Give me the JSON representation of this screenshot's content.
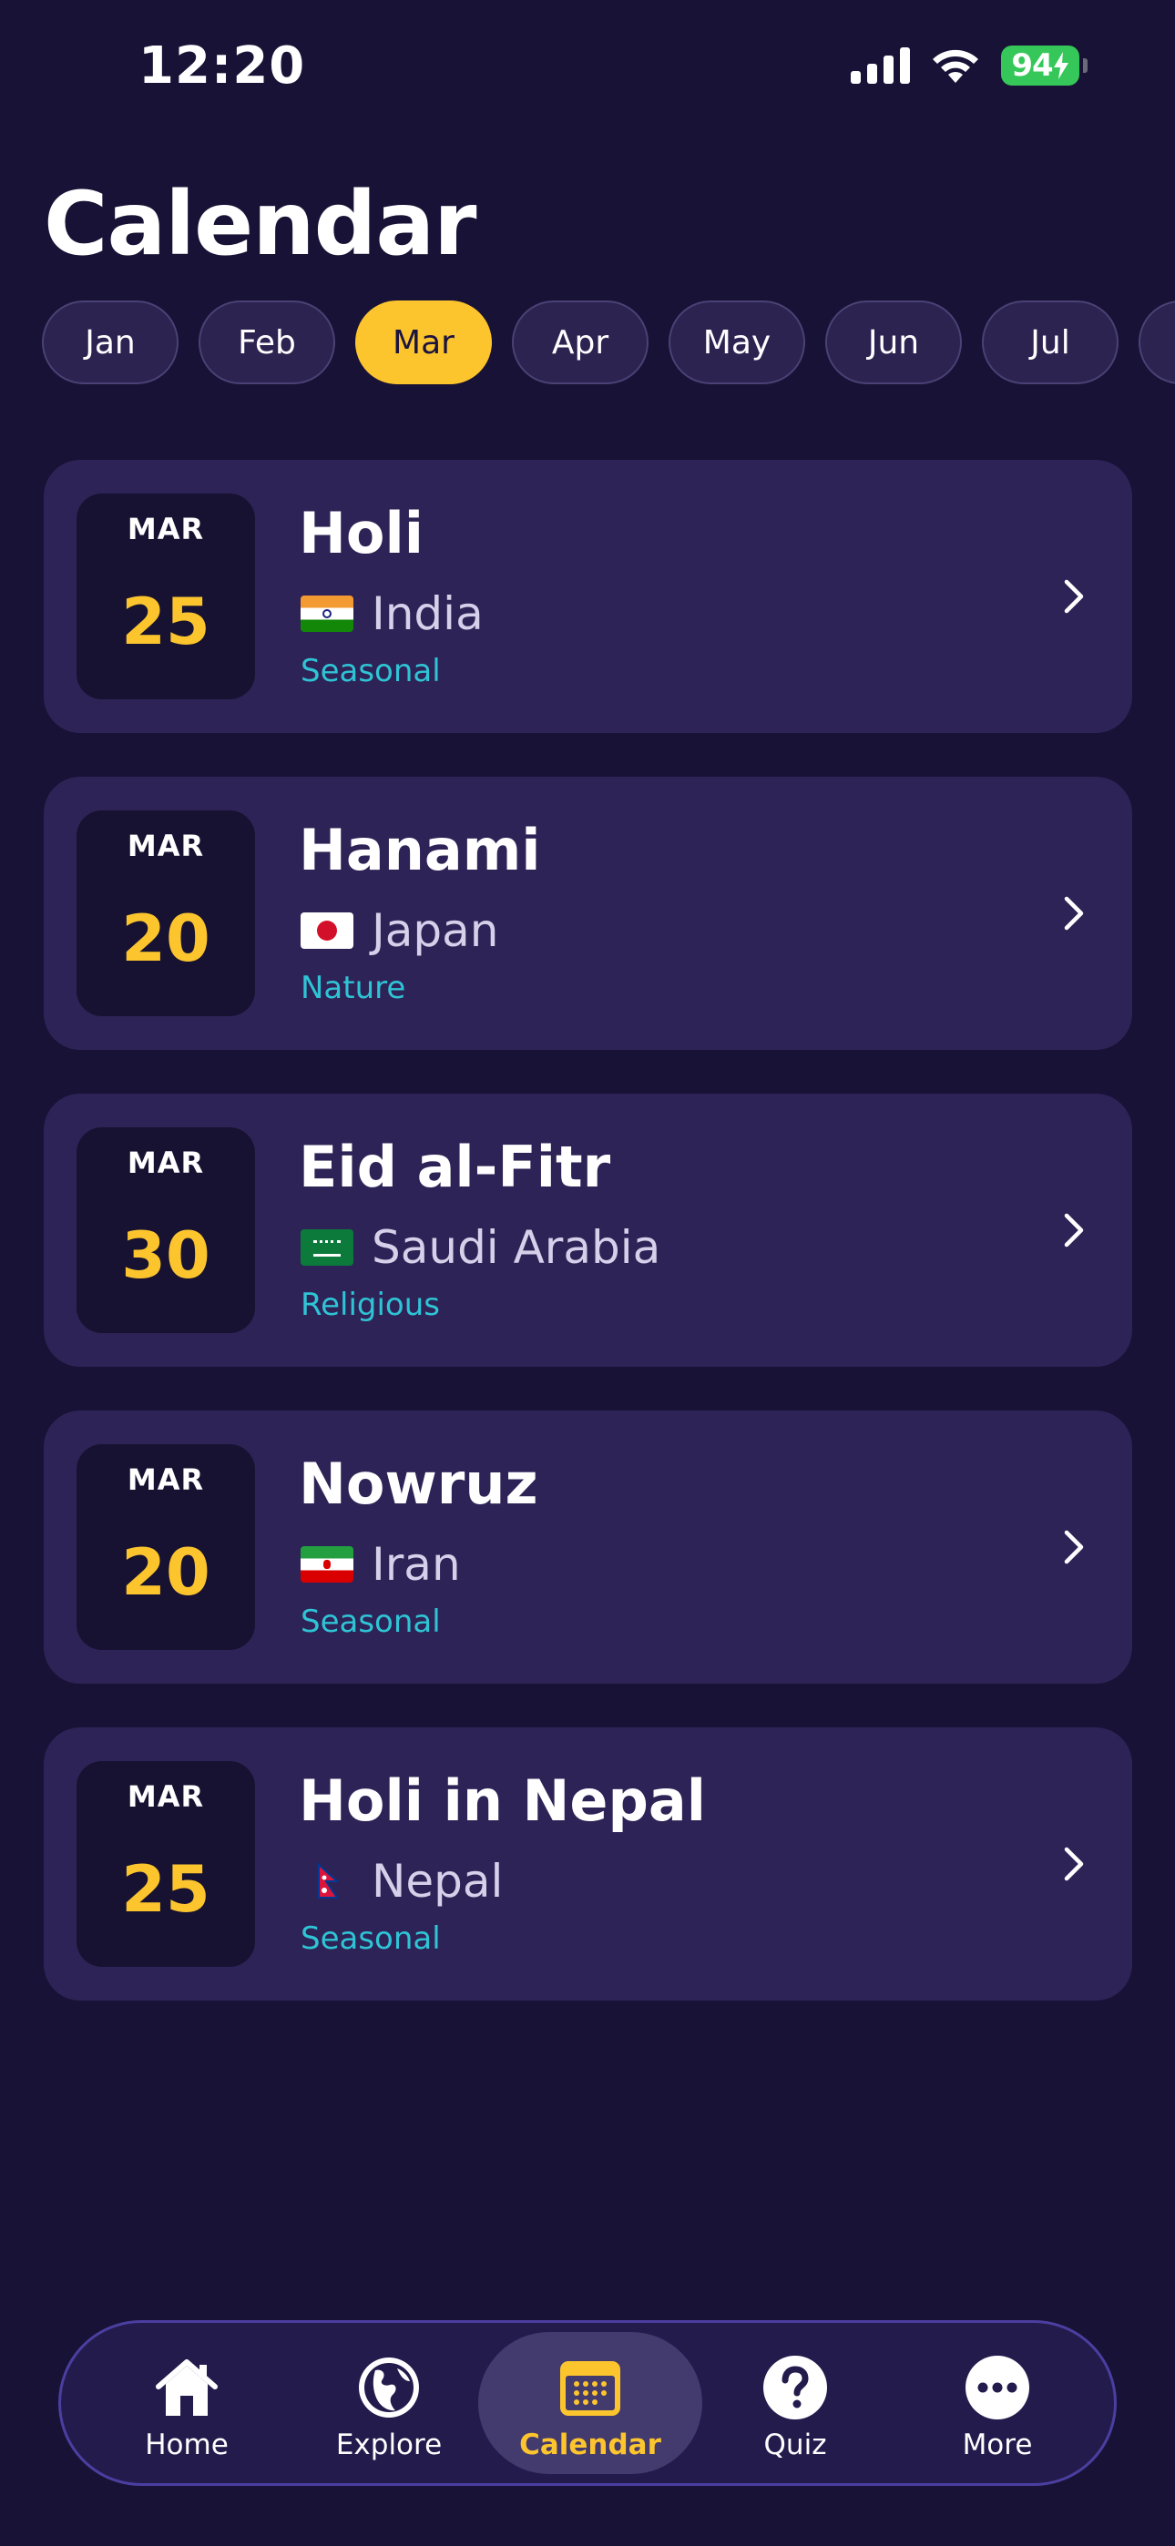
{
  "status_bar": {
    "time": "12:20",
    "battery": "94"
  },
  "page": {
    "title": "Calendar"
  },
  "months": [
    "Jan",
    "Feb",
    "Mar",
    "Apr",
    "May",
    "Jun",
    "Jul",
    ""
  ],
  "selected_month": "Mar",
  "events": [
    {
      "month": "MAR",
      "day": "25",
      "name": "Holi",
      "country": "India",
      "flag": "india-flag-icon",
      "category": "Seasonal"
    },
    {
      "month": "MAR",
      "day": "20",
      "name": "Hanami",
      "country": "Japan",
      "flag": "japan-flag-icon",
      "category": "Nature"
    },
    {
      "month": "MAR",
      "day": "30",
      "name": "Eid al-Fitr",
      "country": "Saudi Arabia",
      "flag": "saudi-arabia-flag-icon",
      "category": "Religious"
    },
    {
      "month": "MAR",
      "day": "20",
      "name": "Nowruz",
      "country": "Iran",
      "flag": "iran-flag-icon",
      "category": "Seasonal"
    },
    {
      "month": "MAR",
      "day": "25",
      "name": "Holi in Nepal",
      "country": "Nepal",
      "flag": "nepal-flag-icon",
      "category": "Seasonal"
    }
  ],
  "nav": {
    "home": "Home",
    "explore": "Explore",
    "calendar": "Calendar",
    "quiz": "Quiz",
    "more": "More"
  },
  "colors": {
    "background": "#181236",
    "card": "#2e2356",
    "accent": "#fcc52e",
    "category": "#2fc4d5",
    "battery": "#35c759"
  }
}
